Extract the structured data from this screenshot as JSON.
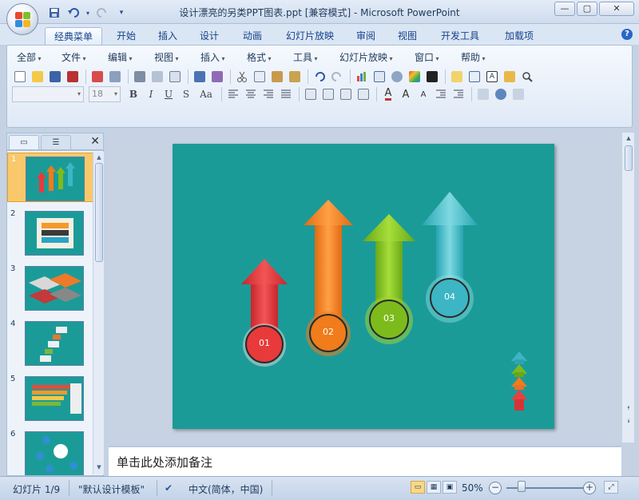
{
  "window": {
    "title": "设计漂亮的另类PPT图表.ppt [兼容模式] - Microsoft PowerPoint",
    "controls": [
      "—",
      "▢",
      "✕"
    ]
  },
  "quick_access": {
    "icons": [
      "save-icon",
      "undo-icon",
      "redo-icon",
      "customize-icon"
    ]
  },
  "ribbon_tabs": [
    "经典菜单",
    "开始",
    "插入",
    "设计",
    "动画",
    "幻灯片放映",
    "审阅",
    "视图",
    "开发工具",
    "加载项"
  ],
  "active_tab": "经典菜单",
  "menus": [
    "全部",
    "文件",
    "编辑",
    "视图",
    "插入",
    "格式",
    "工具",
    "幻灯片放映",
    "窗口",
    "帮助"
  ],
  "font": {
    "name_value": "",
    "size_value": "18"
  },
  "format_buttons": [
    "B",
    "I",
    "U",
    "S",
    "Aa"
  ],
  "slide_pane": {
    "slides": [
      {
        "num": "1"
      },
      {
        "num": "2"
      },
      {
        "num": "3"
      },
      {
        "num": "4"
      },
      {
        "num": "5"
      },
      {
        "num": "6"
      }
    ],
    "selected": "1"
  },
  "slide": {
    "background": "#1b9b98",
    "arrows": [
      {
        "label": "01",
        "color": "#e83a3a"
      },
      {
        "label": "02",
        "color": "#f07c1b"
      },
      {
        "label": "03",
        "color": "#7dbb1c"
      },
      {
        "label": "04",
        "color": "#3cb6c4"
      }
    ]
  },
  "notes": {
    "placeholder": "单击此处添加备注"
  },
  "status": {
    "slide_info": "幻灯片 1/9",
    "template": "\"默认设计模板\"",
    "language": "中文(简体，中国)",
    "zoom": "50%"
  },
  "colors": {
    "accent": "#15428b",
    "ribbon_bg": "#dfe9f6",
    "selected_thumb": "#f9c86b"
  }
}
